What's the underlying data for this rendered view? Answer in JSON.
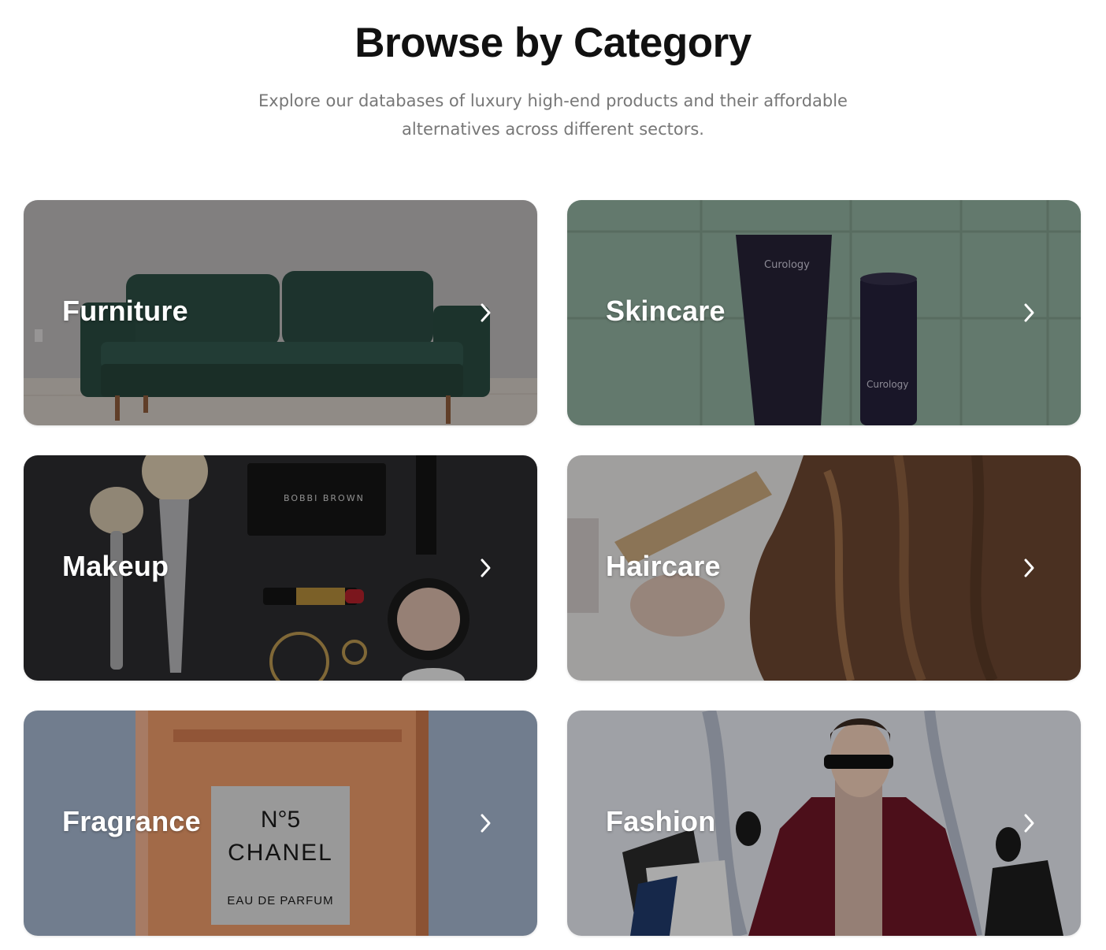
{
  "header": {
    "title": "Browse by Category",
    "subtitle": "Explore our databases of luxury high-end products and their affordable alternatives across different sectors."
  },
  "categories": [
    {
      "label": "Furniture",
      "icon": "chevron-right-icon"
    },
    {
      "label": "Skincare",
      "icon": "chevron-right-icon"
    },
    {
      "label": "Makeup",
      "icon": "chevron-right-icon"
    },
    {
      "label": "Haircare",
      "icon": "chevron-right-icon"
    },
    {
      "label": "Fragrance",
      "icon": "chevron-right-icon"
    },
    {
      "label": "Fashion",
      "icon": "chevron-right-icon"
    }
  ],
  "image_text": {
    "skincare_brand": "Curology",
    "makeup_brand": "BOBBI BROWN",
    "fragrance_number": "N°5",
    "fragrance_brand": "CHANEL",
    "fragrance_type": "EAU DE PARFUM"
  },
  "colors": {
    "heading": "#111111",
    "subtitle": "#777777",
    "card_text": "#ffffff"
  }
}
